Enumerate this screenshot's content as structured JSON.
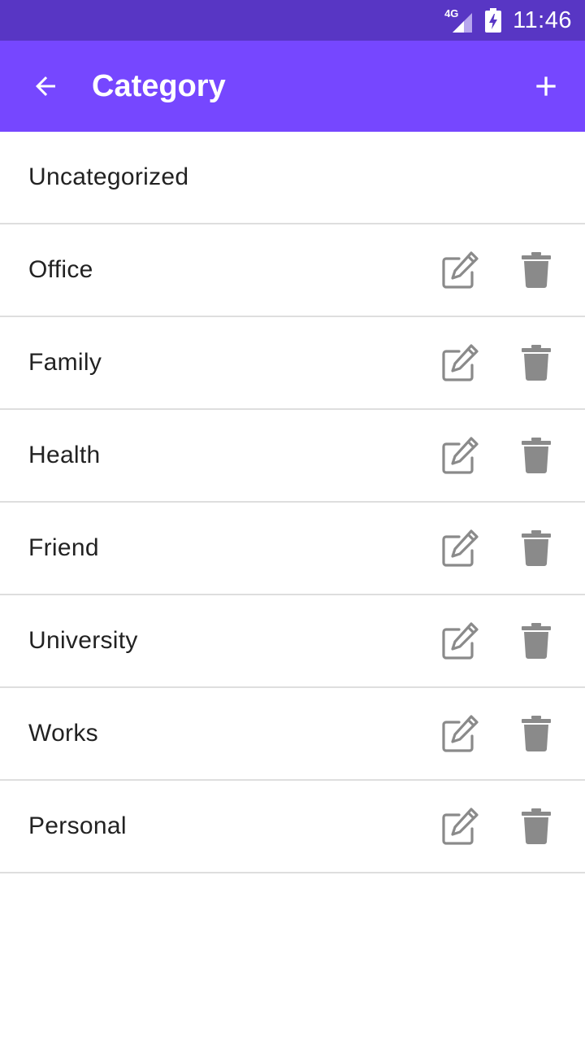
{
  "status_bar": {
    "network": "4G",
    "time": "11:46",
    "color": "#5836c4"
  },
  "app_bar": {
    "title": "Category",
    "back_icon": "arrow-left-icon",
    "add_icon": "plus-icon",
    "color": "#7647ff"
  },
  "categories": [
    {
      "label": "Uncategorized",
      "editable": false
    },
    {
      "label": "Office",
      "editable": true
    },
    {
      "label": "Family",
      "editable": true
    },
    {
      "label": "Health",
      "editable": true
    },
    {
      "label": "Friend",
      "editable": true
    },
    {
      "label": "University",
      "editable": true
    },
    {
      "label": "Works",
      "editable": true
    },
    {
      "label": "Personal",
      "editable": true
    }
  ],
  "icons": {
    "edit": "edit-icon",
    "delete": "trash-icon",
    "color": "#8a8a8a"
  }
}
